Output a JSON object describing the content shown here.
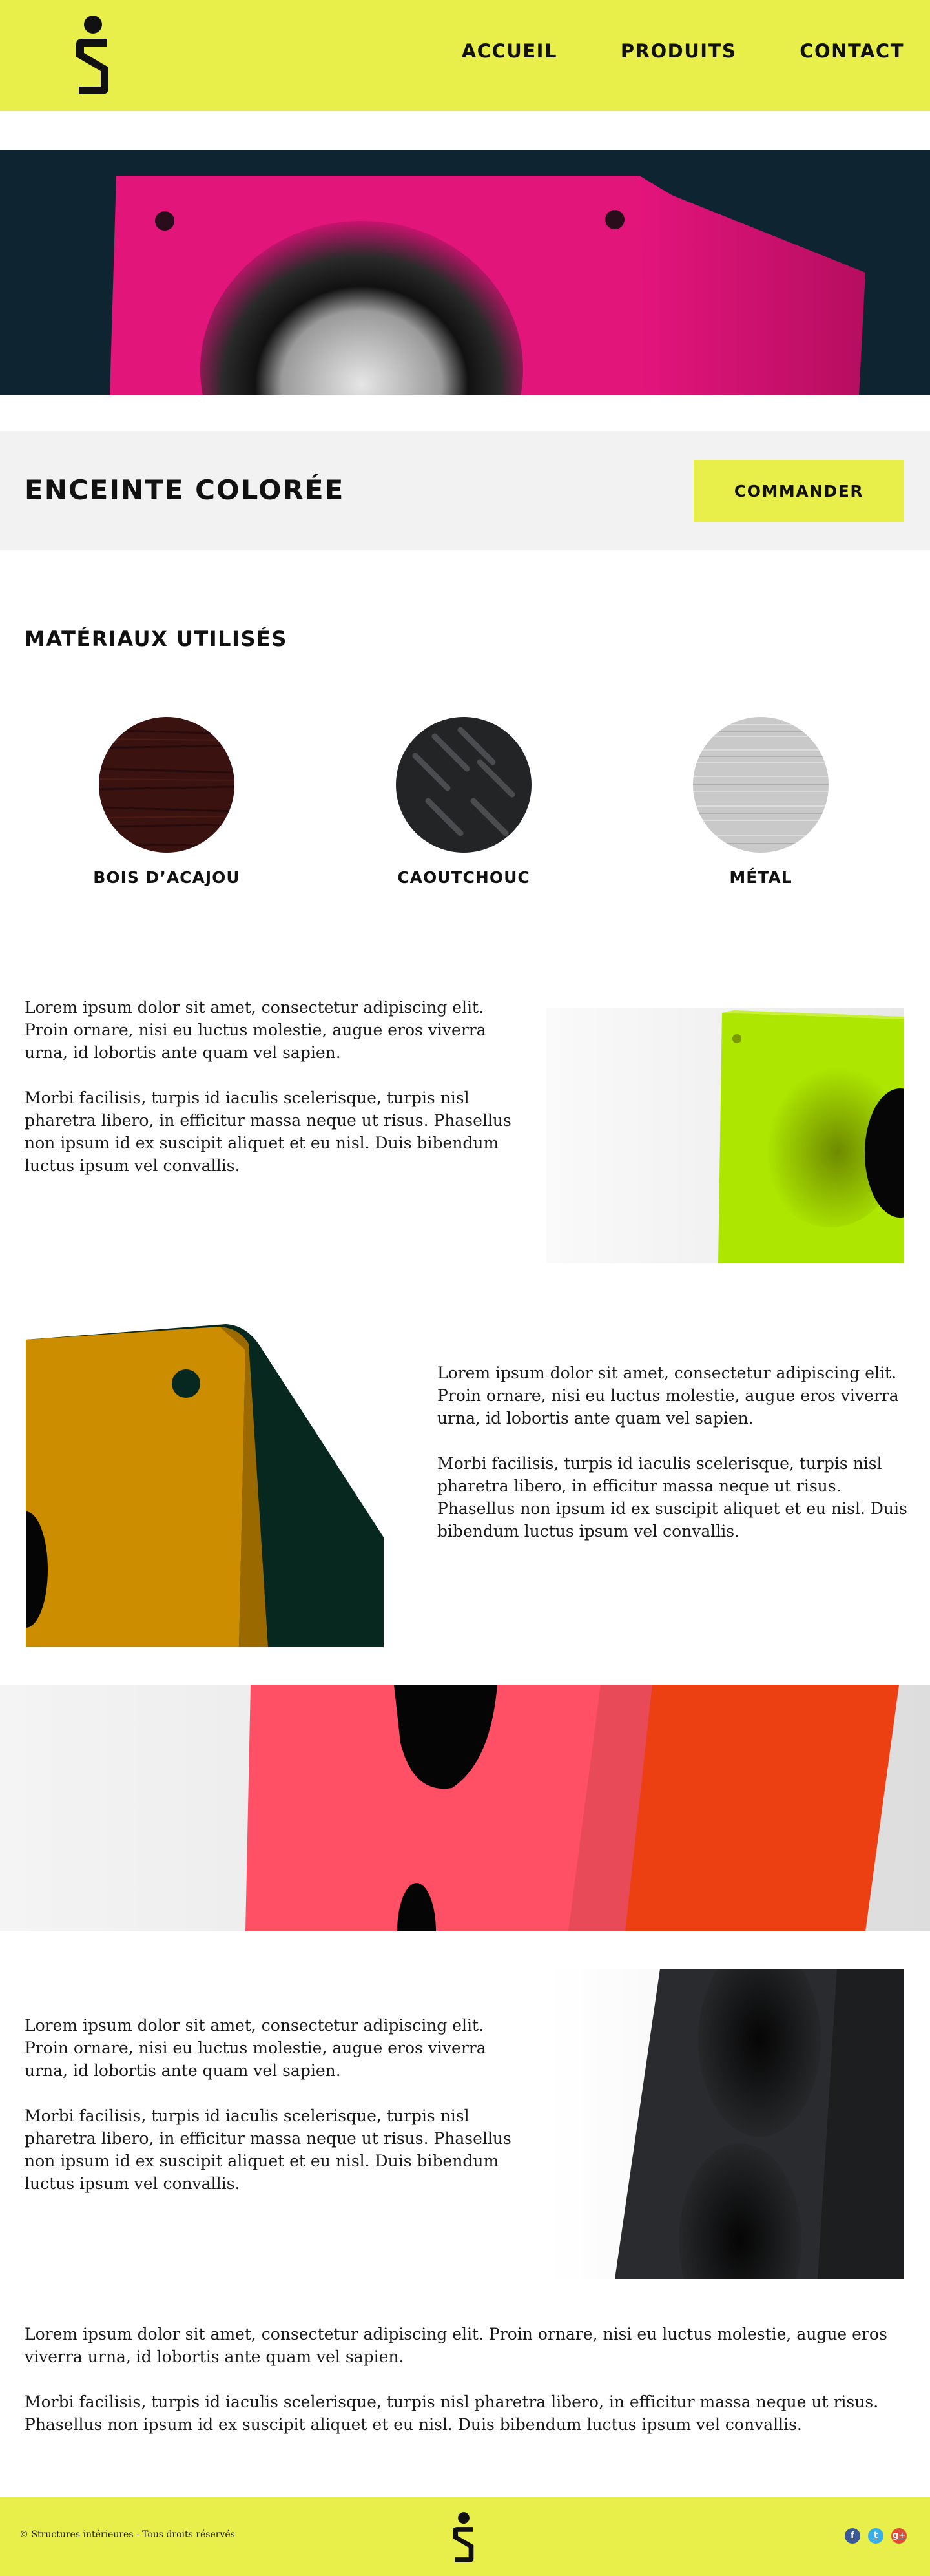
{
  "nav": {
    "items": [
      {
        "label": "ACCUEIL"
      },
      {
        "label": "PRODUITS"
      },
      {
        "label": "CONTACT"
      }
    ]
  },
  "hero": {
    "icon": "pink-speaker-image"
  },
  "product": {
    "title": "ENCEINTE COLORÉE",
    "order_label": "COMMANDER"
  },
  "materials": {
    "title": "MATÉRIAUX UTILISÉS",
    "items": [
      {
        "label": "BOIS D’ACAJOU",
        "color": "#3a1210"
      },
      {
        "label": "CAOUTCHOUC",
        "color": "#232426"
      },
      {
        "label": "MÉTAL",
        "color": "#c8c8c8"
      }
    ]
  },
  "sections": [
    {
      "p1": "Lorem ipsum dolor sit amet, consectetur adipiscing elit. Proin ornare, nisi eu luctus molestie, augue eros viverra urna, id lobortis ante quam vel sapien.",
      "p2": " Morbi facilisis, turpis id iaculis scelerisque, turpis nisl pharetra libero, in efficitur massa neque ut risus. Phasellus non ipsum id ex suscipit aliquet et eu nisl. Duis bibendum luctus ipsum vel convallis."
    },
    {
      "p1": "Lorem ipsum dolor sit amet, consectetur adipiscing elit. Proin ornare, nisi eu luctus molestie, augue eros viverra urna, id lobortis ante quam vel sapien.",
      "p2": " Morbi facilisis, turpis id iaculis scelerisque, turpis nisl pharetra libero, in efficitur massa neque ut risus. Phasellus non ipsum id ex suscipit aliquet et eu nisl. Duis bibendum luctus ipsum vel convallis."
    },
    {
      "p1": "Lorem ipsum dolor sit amet, consectetur adipiscing elit. Proin ornare, nisi eu luctus molestie, augue eros viverra urna, id lobortis ante quam vel sapien.",
      "p2": " Morbi facilisis, turpis id iaculis scelerisque, turpis nisl pharetra libero, in efficitur massa neque ut risus. Phasellus non ipsum id ex suscipit aliquet et eu nisl. Duis bibendum luctus ipsum vel convallis."
    },
    {
      "p1": "Lorem ipsum dolor sit amet, consectetur adipiscing elit. Proin ornare, nisi eu luctus molestie, augue eros viverra urna, id lobortis ante quam vel sapien.",
      "p2": " Morbi facilisis, turpis id iaculis scelerisque, turpis nisl pharetra libero, in efficitur massa neque ut risus. Phasellus non ipsum id ex suscipit aliquet et eu nisl. Duis bibendum luctus ipsum vel convallis."
    }
  ],
  "footer": {
    "copyright": "© Structures intérieures - Tous droits réservés",
    "socials": [
      {
        "icon": "facebook-icon",
        "glyph": "f",
        "color": "#3b5998"
      },
      {
        "icon": "twitter-icon",
        "glyph": "t",
        "color": "#3aaee6"
      },
      {
        "icon": "google-plus-icon",
        "glyph": "g+",
        "color": "#dd4b39"
      }
    ]
  },
  "colors": {
    "brand_yellow": "#e8ee4a",
    "panel_grey": "#f2f2f2"
  }
}
